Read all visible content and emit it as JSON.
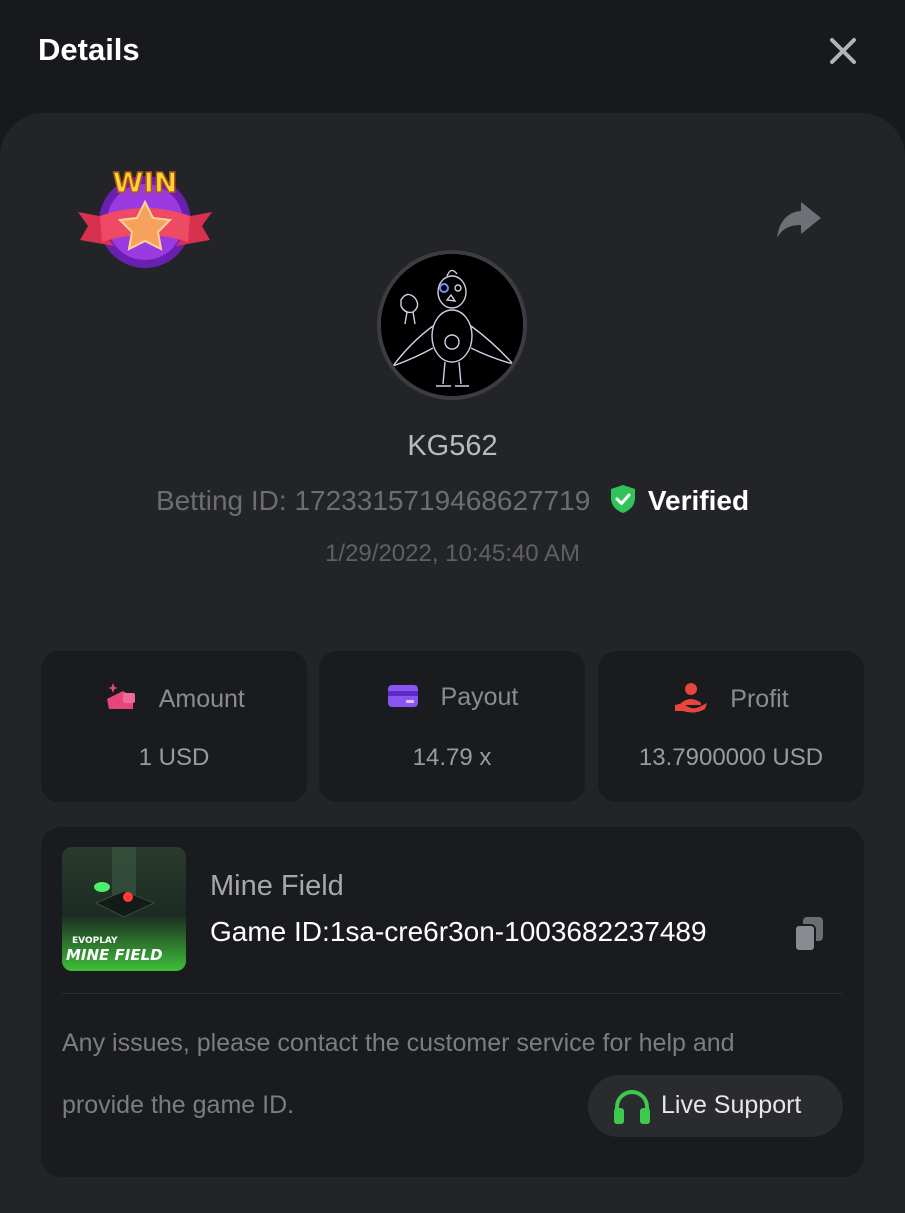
{
  "header": {
    "title": "Details",
    "close_icon": "close-icon"
  },
  "badge": {
    "text": "WIN"
  },
  "share": {
    "icon": "share-icon"
  },
  "user": {
    "username": "KG562",
    "betting_label": "Betting ID:",
    "betting_id": "1723315719468627719",
    "verified_label": "Verified",
    "timestamp": "1/29/2022, 10:45:40 AM"
  },
  "stats": [
    {
      "label": "Amount",
      "value": "1 USD",
      "icon": "coins-hand-icon",
      "color": "#e8457a"
    },
    {
      "label": "Payout",
      "value": "14.79 x",
      "icon": "card-icon",
      "color": "#8b55f5"
    },
    {
      "label": "Profit",
      "value": "13.7900000 USD",
      "icon": "profit-hand-icon",
      "color": "#e8453c"
    }
  ],
  "game": {
    "name": "Mine Field",
    "id_label": "Game ID:",
    "id": "1sa-cre6r3on-1003682237489",
    "thumb_brand": "EVOPLAY",
    "thumb_title": "MINE FIELD"
  },
  "support": {
    "notice_line1": "Any issues, please contact the customer service for help and",
    "notice_line2": "provide the game ID.",
    "button_label": "Live Support"
  },
  "colors": {
    "background": "#18191c",
    "panel": "#232428",
    "card": "#1a1b1e",
    "verified": "#2fc35a",
    "support_icon": "#3ec84d"
  }
}
